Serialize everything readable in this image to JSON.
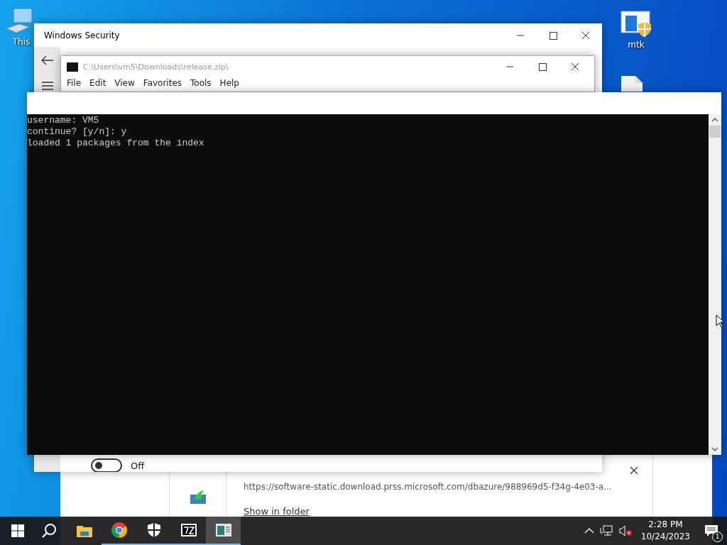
{
  "desktop_icons": [
    {
      "kind": "computer",
      "label": "This"
    },
    {
      "kind": "shield-app",
      "label": "mtk"
    },
    {
      "kind": "file"
    }
  ],
  "security_window": {
    "title": "Windows Security",
    "toggle": {
      "label": "Off",
      "on": false
    }
  },
  "archive_window": {
    "title": "C:\\Users\\vm5\\Downloads\\release.zip\\",
    "menu": [
      "File",
      "Edit",
      "View",
      "Favorites",
      "Tools",
      "Help"
    ]
  },
  "console_window": {
    "lines": [
      "username: VM5",
      "continue? [y/n]: y",
      "loaded 1 packages from the index"
    ]
  },
  "download": {
    "url": "https://software-static.download.prss.microsoft.com/dbazure/988969d5-f34g-4e03-a...",
    "action": "Show in folder"
  },
  "taskbar": {
    "apps": [
      {
        "kind": "explorer",
        "running": false,
        "active": false
      },
      {
        "kind": "chrome",
        "running": true,
        "active": false
      },
      {
        "kind": "shield",
        "running": true,
        "active": false
      },
      {
        "kind": "sevenzip",
        "running": true,
        "active": false
      },
      {
        "kind": "app",
        "running": true,
        "active": true
      }
    ],
    "time": "2:28 PM",
    "date": "10/24/2023",
    "notifications": "1"
  }
}
